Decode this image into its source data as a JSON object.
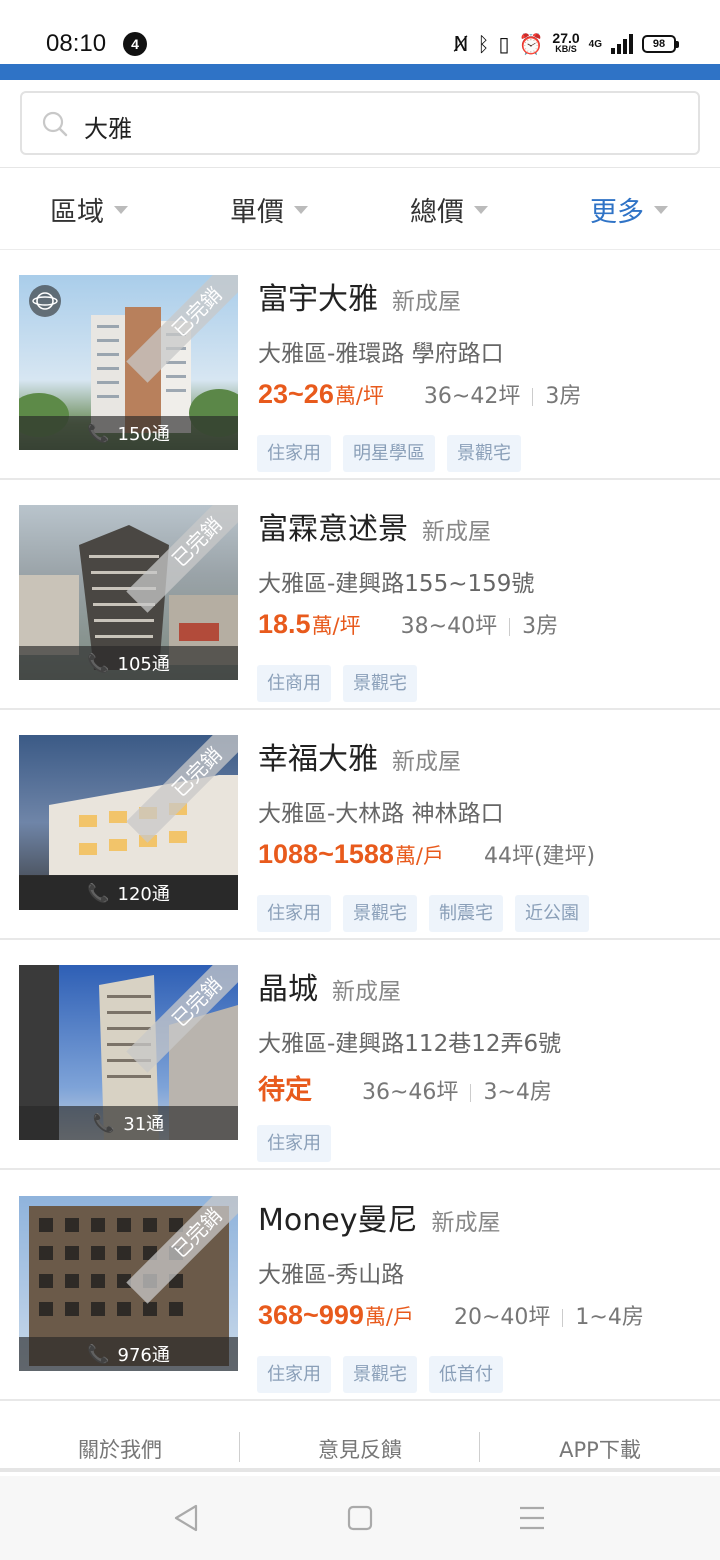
{
  "status_bar": {
    "time": "08:10",
    "notification_count": "4",
    "net_speed": "27.0",
    "net_speed_unit": "KB/S",
    "network": "4G",
    "battery": "98"
  },
  "search": {
    "query": "大雅"
  },
  "filters": [
    {
      "label": "區域"
    },
    {
      "label": "單價"
    },
    {
      "label": "總價"
    },
    {
      "label": "更多"
    }
  ],
  "ribbon_label": "已完銷",
  "listings": [
    {
      "title": "富宇大雅",
      "type": "新成屋",
      "address": "大雅區-雅環路 學府路口",
      "price": "23~26",
      "unit": "萬/坪",
      "size": "36~42坪",
      "rooms": "3房",
      "calls": "150通",
      "tags": [
        "住家用",
        "明星學區",
        "景觀宅"
      ]
    },
    {
      "title": "富霖意述景",
      "type": "新成屋",
      "address": "大雅區-建興路155~159號",
      "price": "18.5",
      "unit": "萬/坪",
      "size": "38~40坪",
      "rooms": "3房",
      "calls": "105通",
      "tags": [
        "住商用",
        "景觀宅"
      ]
    },
    {
      "title": "幸福大雅",
      "type": "新成屋",
      "address": "大雅區-大林路 神林路口",
      "price": "1088~1588",
      "unit": "萬/戶",
      "size": "44坪(建坪)",
      "rooms": "",
      "calls": "120通",
      "tags": [
        "住家用",
        "景觀宅",
        "制震宅",
        "近公園"
      ]
    },
    {
      "title": "晶城",
      "type": "新成屋",
      "address": "大雅區-建興路112巷12弄6號",
      "price": "待定",
      "unit": "",
      "size": "36~46坪",
      "rooms": "3~4房",
      "calls": "31通",
      "tags": [
        "住家用"
      ]
    },
    {
      "title": "Money曼尼",
      "type": "新成屋",
      "address": "大雅區-秀山路",
      "price": "368~999",
      "unit": "萬/戶",
      "size": "20~40坪",
      "rooms": "1~4房",
      "calls": "976通",
      "tags": [
        "住家用",
        "景觀宅",
        "低首付"
      ]
    }
  ],
  "footer": {
    "about": "關於我們",
    "feedback": "意見反饋",
    "app": "APP下載"
  },
  "colors": {
    "accent": "#2f73c6",
    "price": "#e85a1c"
  }
}
